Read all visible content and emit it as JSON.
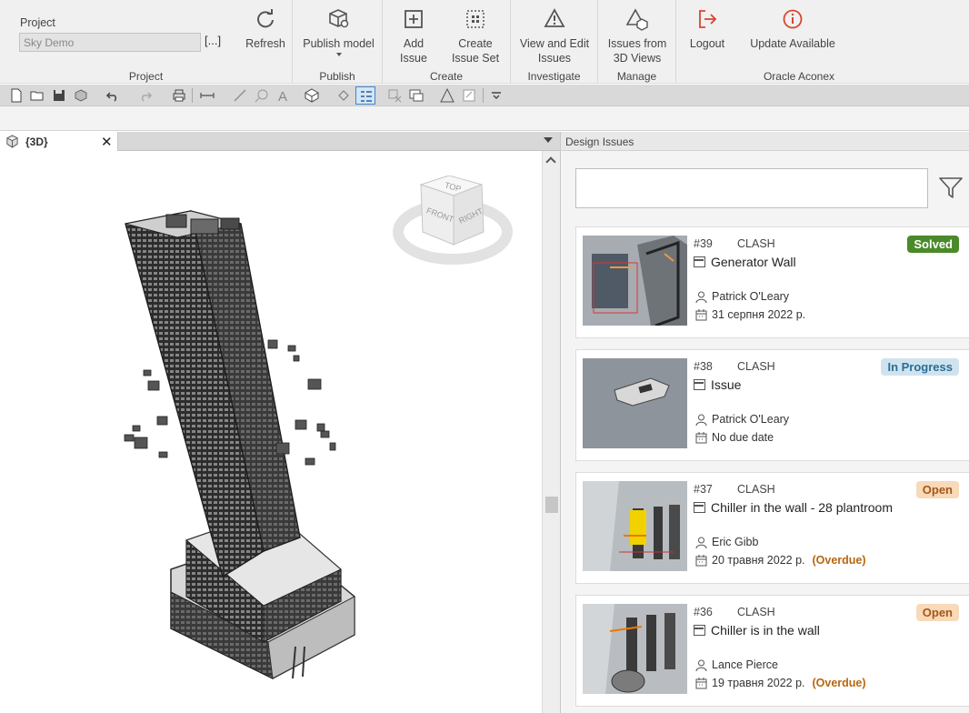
{
  "ribbon": {
    "project_label": "Project",
    "project_value": "Sky Demo",
    "browse": "[...]",
    "refresh": "Refresh",
    "publish_model": "Publish model",
    "add_issue_1": "Add",
    "add_issue_2": "Issue",
    "create_set_1": "Create",
    "create_set_2": "Issue Set",
    "view_edit_1": "View and Edit",
    "view_edit_2": "Issues",
    "issues_views_1": "Issues from",
    "issues_views_2": "3D  Views",
    "logout": "Logout",
    "update": "Update Available",
    "groups": {
      "project": "Project",
      "publish": "Publish",
      "create": "Create",
      "investigate": "Investigate",
      "manage": "Manage",
      "oracle": "Oracle Aconex"
    }
  },
  "view_tab": {
    "label": "{3D}",
    "close": "✕"
  },
  "view_cube": {
    "top": "TOP",
    "front": "FRONT",
    "right": "RIGHT"
  },
  "panel": {
    "title": "Design Issues",
    "search_value": "",
    "issues": [
      {
        "number": "#39",
        "type": "CLASH",
        "title": "Generator Wall",
        "assignee": "Patrick O'Leary",
        "date": "31 серпня 2022 р.",
        "overdue": "",
        "status": "Solved"
      },
      {
        "number": "#38",
        "type": "CLASH",
        "title": "Issue",
        "assignee": "Patrick O'Leary",
        "date": "No due date",
        "overdue": "",
        "status": "In Progress"
      },
      {
        "number": "#37",
        "type": "CLASH",
        "title": "Chiller in the wall - 28 plantroom",
        "assignee": "Eric Gibb",
        "date": "20 травня 2022 р.",
        "overdue": "(Overdue)",
        "status": "Open"
      },
      {
        "number": "#36",
        "type": "CLASH",
        "title": "Chiller is in the wall",
        "assignee": "Lance Pierce",
        "date": "19 травня 2022 р.",
        "overdue": "(Overdue)",
        "status": "Open"
      }
    ]
  },
  "colors": {
    "solved": "#4a8a2a",
    "in_progress": "#cfe3ee",
    "open": "#f8d9b8",
    "overdue": "#b8660f",
    "logout": "#d9452f"
  }
}
